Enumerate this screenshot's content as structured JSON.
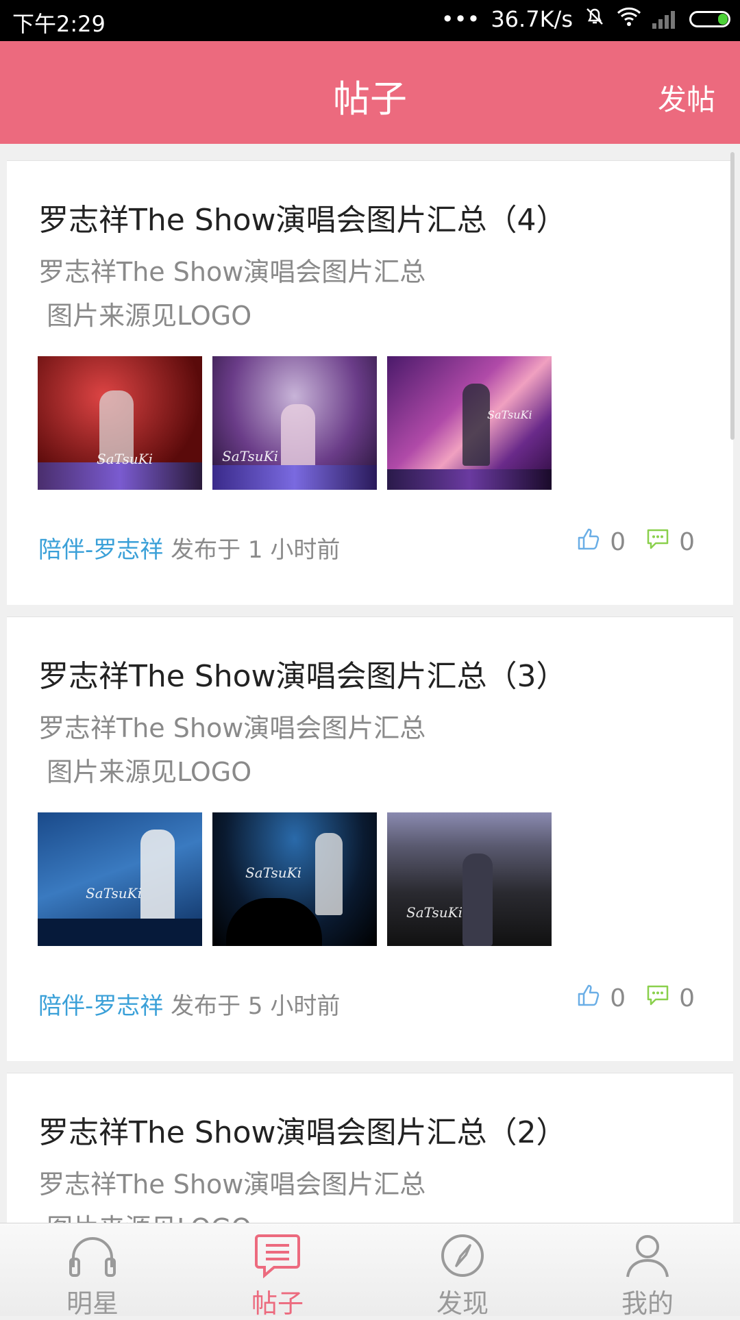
{
  "status_bar": {
    "time": "下午2:29",
    "network_speed": "36.7K/s"
  },
  "header": {
    "title": "帖子",
    "post_button": "发帖"
  },
  "posts": [
    {
      "title": "罗志祥The Show演唱会图片汇总（4）",
      "excerpt_line1": "罗志祥The Show演唱会图片汇总",
      "excerpt_line2": " 图片来源见LOGO",
      "author": "陪伴-罗志祥",
      "published": "发布于 1 小时前",
      "likes": "0",
      "comments": "0",
      "watermark": "SaTsuKi"
    },
    {
      "title": "罗志祥The Show演唱会图片汇总（3）",
      "excerpt_line1": "罗志祥The Show演唱会图片汇总",
      "excerpt_line2": " 图片来源见LOGO",
      "author": "陪伴-罗志祥",
      "published": "发布于 5 小时前",
      "likes": "0",
      "comments": "0",
      "watermark": "SaTsuKi"
    },
    {
      "title": "罗志祥The Show演唱会图片汇总（2）",
      "excerpt_line1": "罗志祥The Show演唱会图片汇总",
      "excerpt_line2": " 图片来源见LOGO"
    }
  ],
  "bottom_nav": [
    {
      "label": "明星",
      "icon": "headphones-icon"
    },
    {
      "label": "帖子",
      "icon": "chat-bubble-icon",
      "active": true
    },
    {
      "label": "发现",
      "icon": "compass-icon"
    },
    {
      "label": "我的",
      "icon": "person-icon"
    }
  ],
  "colors": {
    "brand": "#ec6a7e",
    "author_link": "#3aa0d8",
    "like_icon": "#6aaee6",
    "comment_icon": "#8ad04c"
  }
}
